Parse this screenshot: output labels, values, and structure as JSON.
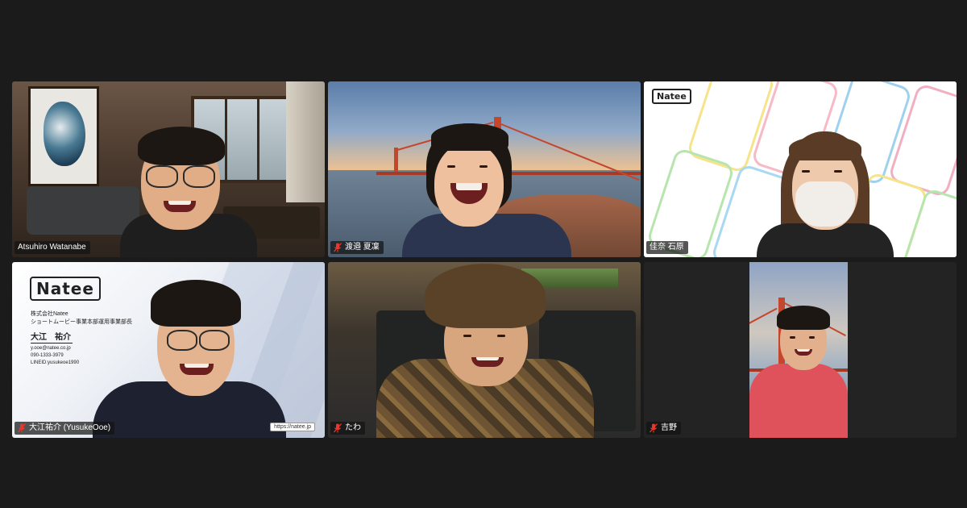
{
  "meeting": {
    "participants": [
      {
        "name": "Atsuhiro Watanabe",
        "muted": false,
        "active": false
      },
      {
        "name": "渡邉 夏凜",
        "muted": true,
        "active": false
      },
      {
        "name": "佳奈 石原",
        "muted": false,
        "active": true
      },
      {
        "name": "大江祐介 (YusukeOoe)",
        "muted": true,
        "active": false
      },
      {
        "name": "たわ",
        "muted": true,
        "active": false
      },
      {
        "name": "吉野",
        "muted": true,
        "active": false
      }
    ]
  },
  "backgrounds": {
    "natee_logo": "Natee",
    "business_card": {
      "logo": "Natee",
      "company": "株式会社Natee",
      "department": "ショートムービー事業本部運用事業部長",
      "person_name": "大江　祐介",
      "email": "y.ooe@natee.co.jp",
      "phone": "090-1333-3979",
      "line_id": "LINEID:yusukeoe1990",
      "url": "https://natee.jp"
    }
  },
  "colors": {
    "active_speaker_border": "#5ad25a",
    "muted_mic": "#e5392d",
    "background": "#1b1b1b"
  },
  "icons": {
    "muted": "mic-muted-icon"
  }
}
